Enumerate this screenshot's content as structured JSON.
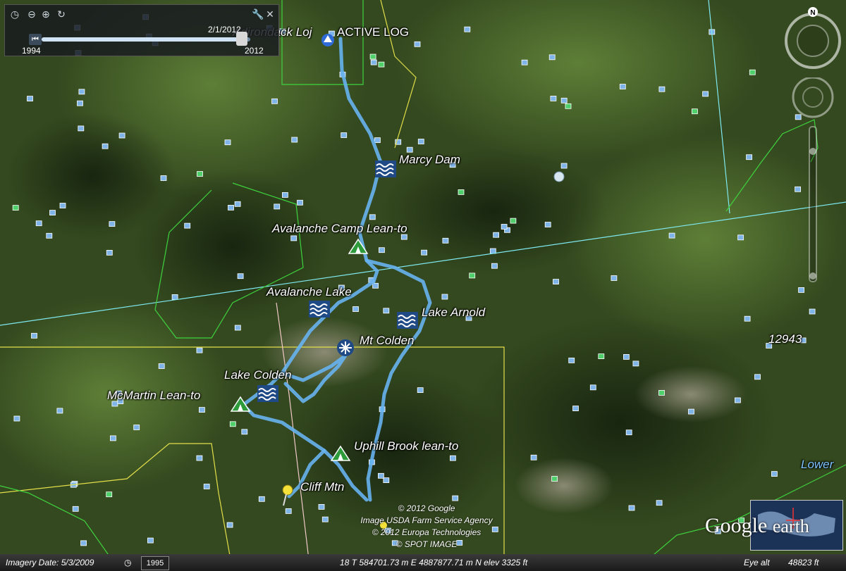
{
  "timeslider": {
    "current_date": "2/1/2012",
    "start_year": "1994",
    "end_year": "2012",
    "position_fraction": 0.96
  },
  "places": {
    "adirondack_loj": "Adirondack Loj",
    "active_log": "ACTIVE LOG",
    "marcy_dam": "Marcy Dam",
    "avalanche_camp": "Avalanche Camp Lean-to",
    "avalanche_lake": "Avalanche Lake",
    "lake_arnold": "Lake Arnold",
    "mt_colden": "Mt Colden",
    "lake_colden": "Lake Colden",
    "mcmartin": "McMartin Lean-to",
    "uphill_brook": "Uphill Brook lean-to",
    "cliff_mtn": "Cliff Mtn",
    "elevation_mark": "12943",
    "lower": "Lower"
  },
  "copyright": [
    "© 2012 Google",
    "Image USDA Farm Service Agency",
    "© 2012 Europa Technologies",
    "© SPOT IMAGE"
  ],
  "status": {
    "imagery_date": "Imagery Date: 5/3/2009",
    "historical_year": "1995",
    "coords": "18 T 584701.73 m E 4887877.71 m N elev  3325 ft",
    "eye_alt_label": "Eye alt",
    "eye_alt_value": "48823 ft"
  },
  "logo": {
    "google": "Google",
    "earth": "earth"
  },
  "compass": {
    "north_label": "N"
  },
  "colors": {
    "track": "#67b3f0",
    "cyan_line": "#7fe8f0",
    "yellow_line": "#e3df4a",
    "green_line": "#3fd23f"
  },
  "icons": {
    "water": "water-waves-icon",
    "leanto": "lean-to-icon",
    "summit": "snowflake-icon",
    "pin": "pushpin-icon",
    "lodge": "lodge-icon"
  }
}
